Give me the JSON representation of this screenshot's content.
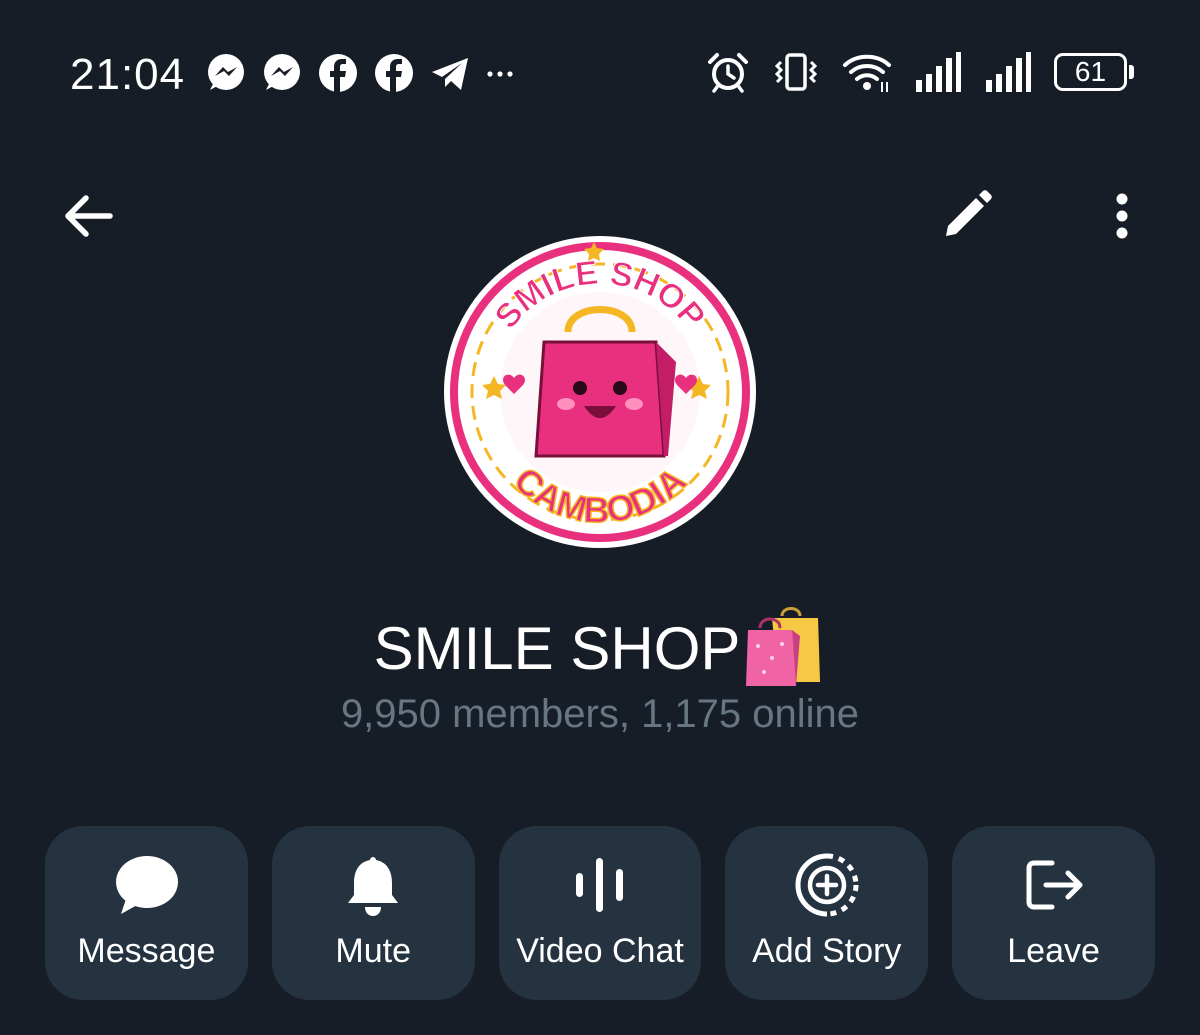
{
  "status_bar": {
    "time": "21:04",
    "notification_icons": [
      "messenger-icon",
      "messenger-icon",
      "facebook-icon",
      "facebook-icon",
      "telegram-icon",
      "more-notifications-icon"
    ],
    "system_icons": [
      "alarm-icon",
      "vibrate-icon",
      "wifi-icon",
      "signal-icon",
      "signal-icon",
      "battery-icon"
    ],
    "battery_level": "61"
  },
  "app_bar": {
    "back_icon": "arrow-left-icon",
    "edit_icon": "pencil-icon",
    "more_icon": "more-vertical-icon"
  },
  "profile": {
    "avatar_logo": {
      "top_text": "SMILE SHOP",
      "bottom_text": "CAMBODIA"
    },
    "title": "SMILE SHOP",
    "title_emoji": "shopping-bags-emoji",
    "subtitle": "9,950 members, 1,175 online"
  },
  "actions": [
    {
      "label": "Message",
      "icon": "chat-bubble-icon"
    },
    {
      "label": "Mute",
      "icon": "bell-icon"
    },
    {
      "label": "Video Chat",
      "icon": "voice-wave-icon"
    },
    {
      "label": "Add Story",
      "icon": "add-story-icon"
    },
    {
      "label": "Leave",
      "icon": "logout-icon"
    }
  ],
  "colors": {
    "background": "#161d27",
    "button_background": "#253341",
    "subtitle": "#687682",
    "logo_pink": "#e8307f",
    "logo_gold": "#f5b623"
  }
}
